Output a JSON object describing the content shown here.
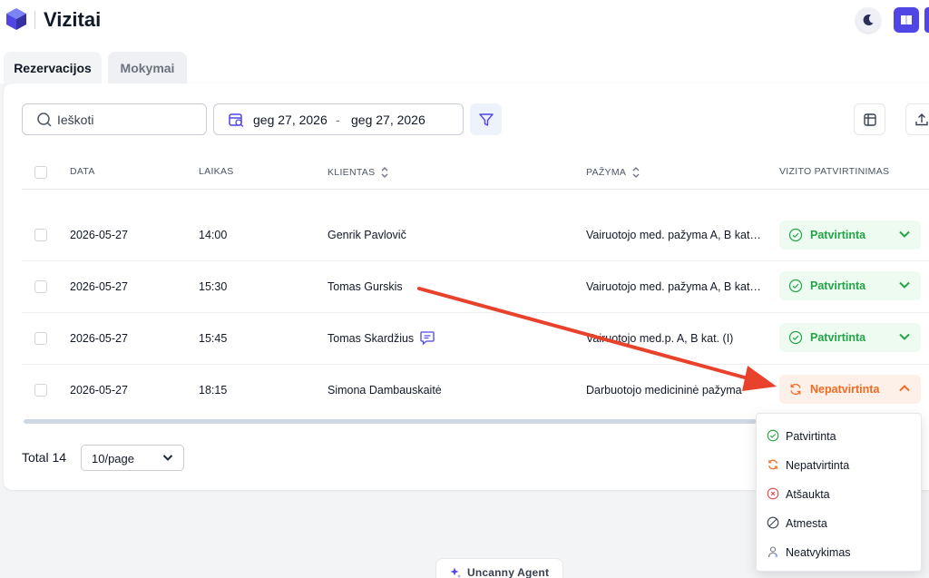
{
  "app": {
    "title": "Vizitai"
  },
  "tabs": [
    {
      "label": "Rezervacijos",
      "active": true
    },
    {
      "label": "Mokymai",
      "active": false
    }
  ],
  "toolbar": {
    "search_placeholder": "Ieškoti",
    "date_from": "geg 27, 2026",
    "date_separator": "-",
    "date_to": "geg 27, 2026"
  },
  "table": {
    "columns": [
      "DATA",
      "LAIKAS",
      "KLIENTAS",
      "PAŽYMA",
      "VIZITO PATVIRTINIMAS"
    ],
    "rows": [
      {
        "date": "2026-05-27",
        "time": "14:00",
        "client": "Genrik Pavlovič",
        "certificate": "Vairuotojo med. pažyma A, B kat. (I)",
        "status": "Patvirtinta",
        "status_type": "confirmed",
        "has_comment": false
      },
      {
        "date": "2026-05-27",
        "time": "15:30",
        "client": "Tomas Gurskis",
        "certificate": "Vairuotojo med. pažyma A, B kat. (I)",
        "status": "Patvirtinta",
        "status_type": "confirmed",
        "has_comment": false
      },
      {
        "date": "2026-05-27",
        "time": "15:45",
        "client": "Tomas Skardžius",
        "certificate": "Vairuotojo med.p. A, B kat. (I)",
        "status": "Patvirtinta",
        "status_type": "confirmed",
        "has_comment": true
      },
      {
        "date": "2026-05-27",
        "time": "18:15",
        "client": "Simona Dambauskaitė",
        "certificate": "Darbuotojo medicininė pažyma",
        "status": "Nepatvirtinta",
        "status_type": "pending",
        "has_comment": false
      }
    ]
  },
  "pagination": {
    "total_label": "Total 14",
    "page_size": "10/page"
  },
  "status_dropdown": {
    "options": [
      {
        "label": "Patvirtinta",
        "icon": "check-circle-icon",
        "color": "#22a447"
      },
      {
        "label": "Nepatvirtinta",
        "icon": "sync-icon",
        "color": "#f26b21"
      },
      {
        "label": "Atšaukta",
        "icon": "x-circle-icon",
        "color": "#e5484d"
      },
      {
        "label": "Atmesta",
        "icon": "slash-circle-icon",
        "color": "#374151"
      },
      {
        "label": "Neatvykimas",
        "icon": "user-absent-icon",
        "color": "#6b7280"
      }
    ]
  },
  "agent": {
    "label": "Uncanny Agent"
  },
  "colors": {
    "accent": "#4f46e5",
    "confirmed": "#22a447",
    "pending": "#f26b21",
    "annotation": "#e8412c"
  }
}
